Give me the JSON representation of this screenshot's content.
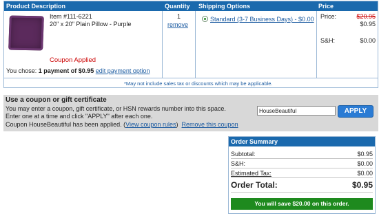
{
  "cart": {
    "headers": {
      "product": "Product Description",
      "quantity": "Quantity",
      "shipping": "Shipping Options",
      "price": "Price"
    },
    "item": {
      "number": "Item #111-6221",
      "name": "20\" x 20\" Plain Pillow - Purple",
      "quantity": "1",
      "remove_label": "remove",
      "coupon_status": "Coupon Applied",
      "payment_prefix": "You chose:",
      "payment_value": "1 payment of $0.95",
      "edit_payment_label": "edit payment option",
      "shipping_option": "Standard (3-7 Business Days) - $0.00",
      "price_label": "Price:",
      "price_original": "$20.95",
      "price_current": "$0.95",
      "sh_label": "S&H:",
      "sh_value": "$0.00"
    },
    "tax_note": "*May not include sales tax or discounts which may be applicable."
  },
  "coupon": {
    "title": "Use a coupon or gift certificate",
    "line1": "You may enter a coupon, gift certificate, or HSN rewards number into this space.",
    "line2": "Enter one at a time and click \"APPLY\" after each one.",
    "applied_text": "Coupon HouseBeautiful has been applied.",
    "view_rules_label": "View coupon rules",
    "remove_label": "Remove this coupon",
    "input_value": "HouseBeautiful",
    "apply_label": "APPLY"
  },
  "summary": {
    "title": "Order Summary",
    "subtotal_label": "Subtotal:",
    "subtotal_value": "$0.95",
    "sh_label": "S&H:",
    "sh_value": "$0.00",
    "tax_label": "Estimated Tax:",
    "tax_value": "$0.00",
    "total_label": "Order Total:",
    "total_value": "$0.95",
    "savings_text": "You will save $20.00 on this order."
  },
  "colors": {
    "header_blue": "#1a69ad",
    "link_blue": "#1a5aa0",
    "alert_red": "#cc0000",
    "save_green": "#1e8a1e",
    "apply_blue": "#2a7bd4"
  },
  "icons": {
    "product_image": "purple-pillow",
    "shipping_radio": "radio-selected"
  }
}
